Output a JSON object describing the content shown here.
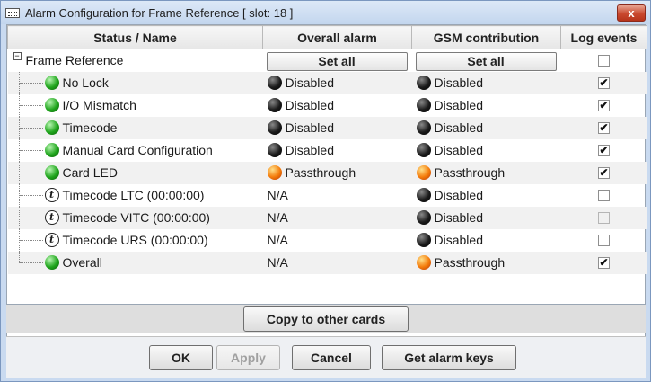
{
  "window": {
    "title": "Alarm Configuration for Frame Reference [ slot: 18 ]",
    "close_label": "x"
  },
  "headers": {
    "status_name": "Status / Name",
    "overall_alarm": "Overall alarm",
    "gsm_contribution": "GSM contribution",
    "log_events": "Log events"
  },
  "group": {
    "expand_glyph": "−",
    "name": "Frame Reference",
    "set_all_overall": "Set all",
    "set_all_gsm": "Set all",
    "log_checked": false
  },
  "rows": [
    {
      "name": "No Lock",
      "status_icon": "green-led-icon",
      "overall": "Disabled",
      "overall_led": "black",
      "gsm": "Disabled",
      "gsm_led": "black",
      "log": true,
      "log_enabled": true
    },
    {
      "name": "I/O Mismatch",
      "status_icon": "green-led-icon",
      "overall": "Disabled",
      "overall_led": "black",
      "gsm": "Disabled",
      "gsm_led": "black",
      "log": true,
      "log_enabled": true
    },
    {
      "name": "Timecode",
      "status_icon": "green-led-icon",
      "overall": "Disabled",
      "overall_led": "black",
      "gsm": "Disabled",
      "gsm_led": "black",
      "log": true,
      "log_enabled": true
    },
    {
      "name": "Manual Card Configuration",
      "status_icon": "green-led-icon",
      "overall": "Disabled",
      "overall_led": "black",
      "gsm": "Disabled",
      "gsm_led": "black",
      "log": true,
      "log_enabled": true
    },
    {
      "name": "Card LED",
      "status_icon": "green-led-icon",
      "overall": "Passthrough",
      "overall_led": "orange",
      "gsm": "Passthrough",
      "gsm_led": "orange",
      "log": true,
      "log_enabled": true
    },
    {
      "name": "Timecode LTC (00:00:00)",
      "status_icon": "info-t-icon",
      "overall": "N/A",
      "overall_led": "none",
      "gsm": "Disabled",
      "gsm_led": "black",
      "log": false,
      "log_enabled": true
    },
    {
      "name": "Timecode VITC (00:00:00)",
      "status_icon": "info-t-icon",
      "overall": "N/A",
      "overall_led": "none",
      "gsm": "Disabled",
      "gsm_led": "black",
      "log": false,
      "log_enabled": false
    },
    {
      "name": "Timecode URS (00:00:00)",
      "status_icon": "info-t-icon",
      "overall": "N/A",
      "overall_led": "none",
      "gsm": "Disabled",
      "gsm_led": "black",
      "log": false,
      "log_enabled": true
    },
    {
      "name": "Overall",
      "status_icon": "green-led-icon",
      "overall": "N/A",
      "overall_led": "none",
      "gsm": "Passthrough",
      "gsm_led": "orange",
      "log": true,
      "log_enabled": true
    }
  ],
  "info_glyph": "t",
  "check_glyph": "✔",
  "buttons": {
    "copy": "Copy to other cards",
    "ok": "OK",
    "apply": "Apply",
    "cancel": "Cancel",
    "get_alarm_keys": "Get alarm keys"
  },
  "colors": {
    "titlebar": "#c9daf0",
    "close": "#c9492f",
    "led_green": "#1fa51c",
    "led_orange": "#f47b0a",
    "led_black": "#1b1b1b"
  }
}
